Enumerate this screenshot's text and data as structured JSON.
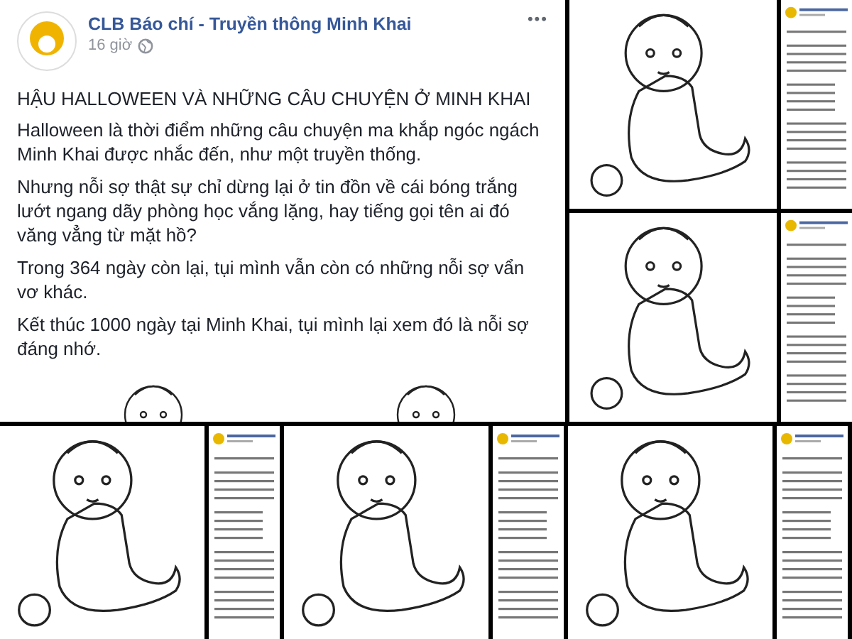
{
  "post": {
    "author": "CLB Báo chí - Truyền thông Minh Khai",
    "time": "16 giờ",
    "more": "•••",
    "title": "HẬU HALLOWEEN VÀ NHỮNG CÂU CHUYỆN Ở MINH KHAI",
    "paragraphs": [
      "Halloween là thời điểm những câu chuyện ma khắp ngóc ngách Minh Khai được nhắc đến, như một truyền thống.",
      "Nhưng nỗi sợ thật sự chỉ dừng lại ở tin đồn về cái bóng trắng lướt ngang dãy phòng học vắng lặng, hay tiếng gọi tên ai đó văng vẳng từ mặt hồ?",
      "Trong 364 ngày còn lại, tụi mình vẫn còn có những nỗi sợ vẩn vơ khác.",
      "Kết thúc 1000 ngày tại Minh Khai, tụi mình lại xem đó là nỗi sợ đáng nhớ."
    ]
  }
}
